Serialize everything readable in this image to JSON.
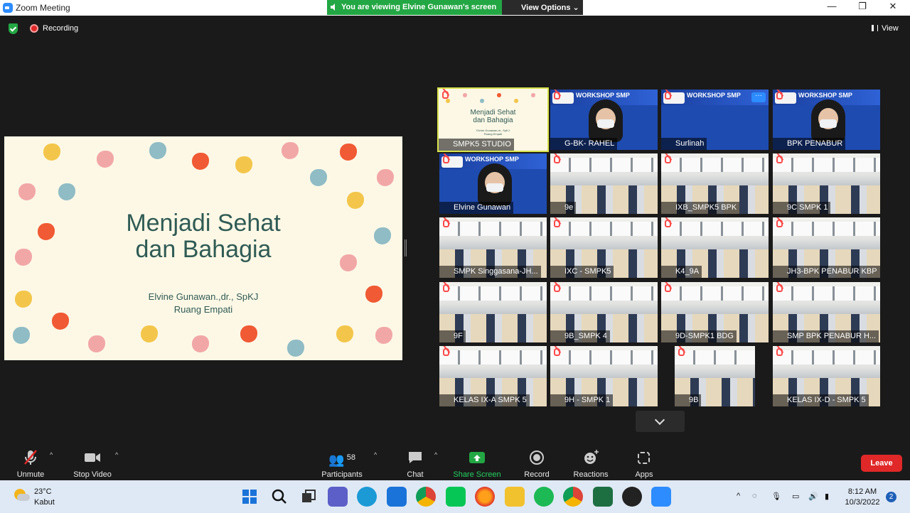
{
  "window": {
    "title": "Zoom Meeting"
  },
  "banner": {
    "viewing_text": "You are viewing Elvine Gunawan's screen",
    "view_options_label": "View Options ⌄"
  },
  "window_controls": {
    "minimize": "—",
    "maximize": "❐",
    "close": "✕"
  },
  "status": {
    "recording_label": "Recording",
    "view_label": "View"
  },
  "shared_slide": {
    "title_line1": "Menjadi Sehat",
    "title_line2": "dan Bahagia",
    "author": "Elvine Gunawan.,dr., SpKJ",
    "organization": "Ruang Empati"
  },
  "mini_slide": {
    "title_line1": "Menjadi Sehat",
    "title_line2": "dan Bahagia",
    "author": "Elvine Gunawan,dr., SpKJ",
    "organization": "Ruang Empati"
  },
  "banner_tile_text": {
    "workshop": "WORKSHOP SMP",
    "subtitle": "\"Cara Menghadapi Stress\"",
    "logo": "PENABUR WELL BEING CAMPAIGN"
  },
  "participants_tiles": [
    {
      "name": "SMPK5 STUDIO",
      "kind": "slide"
    },
    {
      "name": "G-BK- RAHEL",
      "kind": "banner-person"
    },
    {
      "name": "Surlinah",
      "kind": "banner"
    },
    {
      "name": "BPK PENABUR",
      "kind": "banner-person"
    },
    {
      "name": "Elvine Gunawan",
      "kind": "banner-person"
    },
    {
      "name": "9e",
      "kind": "room"
    },
    {
      "name": "IXB_SMPK5 BPK",
      "kind": "room"
    },
    {
      "name": "9C SMPK 1",
      "kind": "room"
    },
    {
      "name": "SMPK Singgasana-JH...",
      "kind": "room"
    },
    {
      "name": "IXC - SMPK5",
      "kind": "room"
    },
    {
      "name": "K4_9A",
      "kind": "room"
    },
    {
      "name": "JH3-BPK PENABUR KBP",
      "kind": "room"
    },
    {
      "name": "9F",
      "kind": "room"
    },
    {
      "name": "9B_SMPK 4",
      "kind": "room"
    },
    {
      "name": "9D-SMPK1 BDG",
      "kind": "room"
    },
    {
      "name": "SMP BPK PENABUR H...",
      "kind": "room"
    },
    {
      "name": "KELAS IX-A SMPK 5",
      "kind": "room"
    },
    {
      "name": "9H - SMPK 1",
      "kind": "room"
    },
    {
      "name": "9B",
      "kind": "room"
    },
    {
      "name": "KELAS IX-D - SMPK 5",
      "kind": "room"
    }
  ],
  "toolbar": {
    "unmute": "Unmute",
    "stop_video": "Stop Video",
    "participants": "Participants",
    "participants_count": "58",
    "chat": "Chat",
    "share_screen": "Share Screen",
    "record": "Record",
    "reactions": "Reactions",
    "apps": "Apps",
    "leave": "Leave"
  },
  "taskbar": {
    "temperature": "23°C",
    "condition": "Kabut",
    "time": "8:12 AM",
    "date": "10/3/2022",
    "notifications": "2"
  },
  "colors": {
    "zoom_blue": "#2d8cff",
    "share_green": "#23a744",
    "leave_red": "#e02828",
    "slide_text": "#2f5b55",
    "slide_bg": "#fdf8e6"
  }
}
